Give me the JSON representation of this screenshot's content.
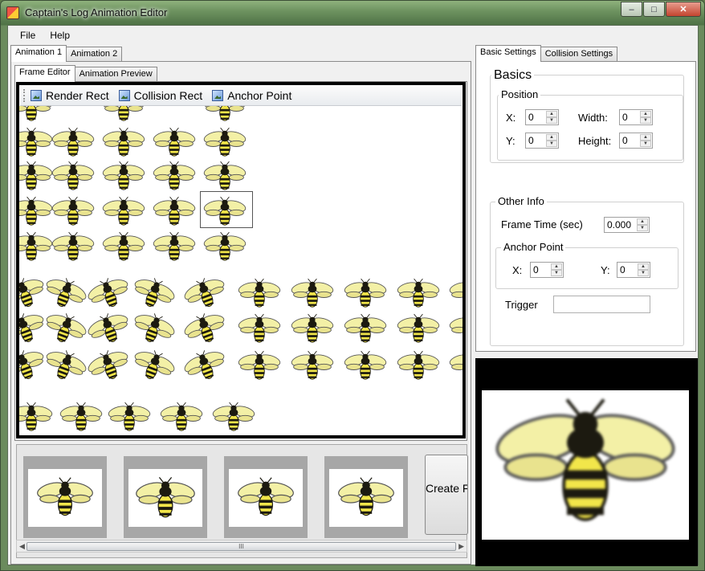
{
  "window": {
    "title": "Captain's Log Animation Editor",
    "buttons": {
      "minimize": "–",
      "maximize": "□",
      "close": "✕"
    }
  },
  "menu": [
    "File",
    "Help"
  ],
  "animation_tabs": [
    "Animation 1",
    "Animation 2"
  ],
  "editor_tabs": [
    "Frame Editor",
    "Animation Preview"
  ],
  "toolbar": [
    "Render Rect",
    "Collision Rect",
    "Anchor Point"
  ],
  "create_frame_label": "Create Frame",
  "scroll_grip": "III",
  "settings_tabs": [
    "Basic Settings",
    "Collision Settings"
  ],
  "basics": {
    "title": "Basics",
    "position_title": "Position",
    "x_label": "X:",
    "x_value": "0",
    "y_label": "Y:",
    "y_value": "0",
    "width_label": "Width:",
    "width_value": "0",
    "height_label": "Height:",
    "height_value": "0"
  },
  "other_info": {
    "title": "Other Info",
    "frame_time_label": "Frame Time (sec)",
    "frame_time_value": "0.000",
    "anchor_title": "Anchor Point",
    "anchor_x_label": "X:",
    "anchor_x_value": "0",
    "anchor_y_label": "Y:",
    "anchor_y_value": "0",
    "trigger_label": "Trigger",
    "trigger_value": ""
  },
  "colors": {
    "bee_yellow": "#f2e64a",
    "bee_black": "#1c1a10",
    "wing": "#f3f0a6",
    "accent": "#3b5d9a"
  }
}
